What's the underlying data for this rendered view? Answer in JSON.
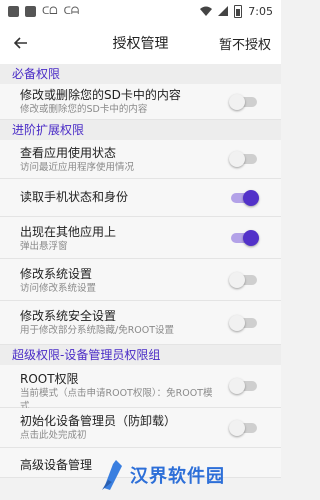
{
  "status_bar": {
    "time": "7:05",
    "icons": [
      "square-icon",
      "square-icon",
      "co-icon",
      "co-icon"
    ]
  },
  "app_bar": {
    "title": "授权管理",
    "action": "暂不授权"
  },
  "sections": [
    {
      "header": "必备权限",
      "rows": [
        {
          "title": "修改或删除您的SD卡中的内容",
          "subtitle": "修改或删除您的SD卡中的内容",
          "enabled": false
        }
      ]
    },
    {
      "header": "进阶扩展权限",
      "rows": [
        {
          "title": "查看应用使用状态",
          "subtitle": "访问最近应用程序使用情况",
          "enabled": false
        },
        {
          "title": "读取手机状态和身份",
          "subtitle": "",
          "enabled": true
        },
        {
          "title": "出现在其他应用上",
          "subtitle": "弹出悬浮窗",
          "enabled": true
        },
        {
          "title": "修改系统设置",
          "subtitle": "访问修改系统设置",
          "enabled": false
        },
        {
          "title": "修改系统安全设置",
          "subtitle": "用于修改部分系统隐藏/免ROOT设置",
          "enabled": false
        }
      ]
    },
    {
      "header": "超级权限-设备管理员权限组",
      "rows": [
        {
          "title": "ROOT权限",
          "subtitle": "当前模式（点击申请ROOT权限）：免ROOT模式",
          "enabled": false
        },
        {
          "title": "初始化设备管理员（防卸载）",
          "subtitle": "点击此处完成初",
          "enabled": false
        },
        {
          "title": "高级设备管理",
          "subtitle": "",
          "enabled": false
        }
      ]
    }
  ],
  "watermark": {
    "text": "汉界软件园"
  }
}
